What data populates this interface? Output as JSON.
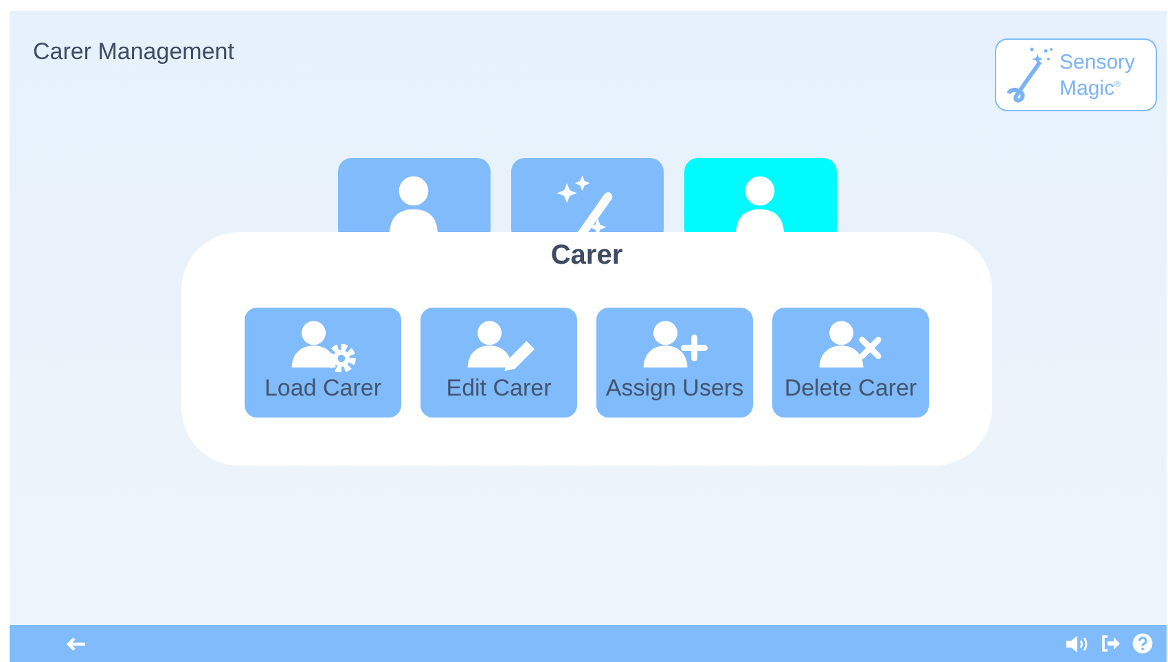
{
  "header": {
    "title": "Carer Management",
    "logo": {
      "line_1": "Sensory",
      "line_2": "Magic",
      "mark": "®"
    }
  },
  "tiles": [
    {
      "kind": "person",
      "selected": false
    },
    {
      "kind": "wand",
      "selected": false
    },
    {
      "kind": "person",
      "selected": true
    }
  ],
  "panel": {
    "title": "Carer",
    "actions": [
      {
        "label": "Load Carer",
        "kind": "gear"
      },
      {
        "label": "Edit Carer",
        "kind": "pencil"
      },
      {
        "label": "Assign Users",
        "kind": "plus"
      },
      {
        "label": "Delete Carer",
        "kind": "cross"
      }
    ]
  },
  "footer": {
    "left": [
      {
        "kind": "back"
      }
    ],
    "right": [
      {
        "kind": "sound"
      },
      {
        "kind": "exit"
      },
      {
        "kind": "help"
      }
    ]
  }
}
